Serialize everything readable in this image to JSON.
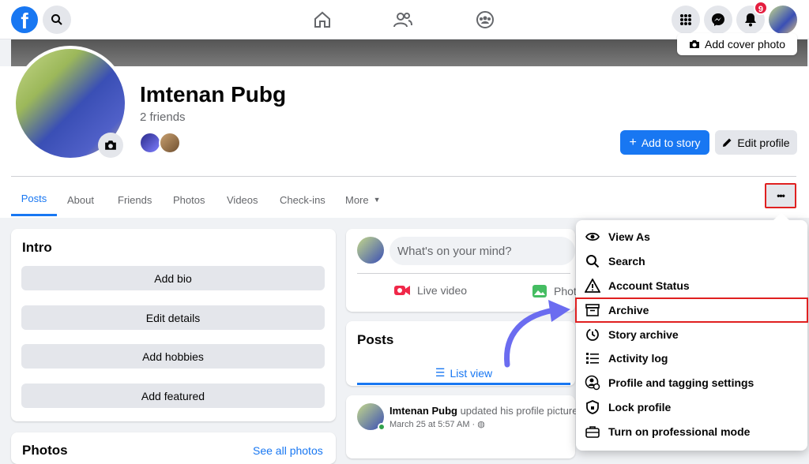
{
  "topnav": {
    "logo": "f",
    "notifications_count": "9"
  },
  "cover": {
    "add_cover_label": "Add cover photo"
  },
  "profile": {
    "name": "Imtenan Pubg",
    "friends": "2 friends",
    "add_story_label": "Add to story",
    "edit_profile_label": "Edit profile"
  },
  "tabs": [
    {
      "label": "Posts"
    },
    {
      "label": "About"
    },
    {
      "label": "Friends"
    },
    {
      "label": "Photos"
    },
    {
      "label": "Videos"
    },
    {
      "label": "Check-ins"
    },
    {
      "label": "More"
    }
  ],
  "more_button": "•••",
  "intro": {
    "title": "Intro",
    "buttons": [
      "Add bio",
      "Edit details",
      "Add hobbies",
      "Add featured"
    ]
  },
  "photos": {
    "title": "Photos",
    "see_all": "See all photos"
  },
  "composer": {
    "placeholder": "What's on your mind?",
    "live_video": "Live video",
    "photo": "Phot"
  },
  "posts": {
    "title": "Posts",
    "list_view": "List view"
  },
  "post": {
    "author": "Imtenan Pubg",
    "action": "updated his profile picture",
    "time": "March 25 at 5:57 AM ·"
  },
  "menu": [
    {
      "label": "View As",
      "icon": "eye-icon"
    },
    {
      "label": "Search",
      "icon": "search-icon"
    },
    {
      "label": "Account Status",
      "icon": "warning-icon"
    },
    {
      "label": "Archive",
      "icon": "archive-icon"
    },
    {
      "label": "Story archive",
      "icon": "clock-icon"
    },
    {
      "label": "Activity log",
      "icon": "list-icon"
    },
    {
      "label": "Profile and tagging settings",
      "icon": "user-gear-icon"
    },
    {
      "label": "Lock profile",
      "icon": "shield-icon"
    },
    {
      "label": "Turn on professional mode",
      "icon": "briefcase-icon"
    }
  ],
  "colors": {
    "brand": "#1877f2",
    "highlight": "#e02020",
    "arrow": "#6b6cf0"
  }
}
